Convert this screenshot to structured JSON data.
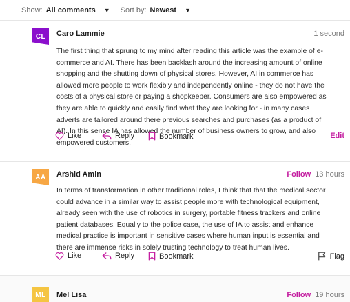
{
  "filters": {
    "show_label": "Show:",
    "show_value": "All comments",
    "sort_label": "Sort by:",
    "sort_value": "Newest"
  },
  "comments": [
    {
      "initials": "CL",
      "author": "Caro Lammie",
      "time": "1 second",
      "avatar_color": "#8b0fcc",
      "body": "The first thing that sprung to my mind after reading this article was the example of e-commerce and AI. There has been backlash around the increasing amount of online shopping and the shutting down of physical stores. However, AI in commerce has allowed more people to work flexibly and independently online - they do not have the costs of a physical store or paying a shopkeeper. Consumers are also empowered as they are able to quickly and easily find what they are looking for - in many cases adverts are tailored around there previous searches and purchases (as a product of AI). In this sense IA has allowed the number of business owners to grow, and also empowered customers.",
      "like_label": "Like",
      "reply_label": "Reply",
      "bookmark_label": "Bookmark",
      "edit_label": "Edit"
    },
    {
      "initials": "AA",
      "author": "Arshid Amin",
      "follow_label": "Follow",
      "time": "13 hours",
      "avatar_color": "#f7a744",
      "body": "In terms of transformation in other traditional roles, I think that that the medical sector could advance in a similar way to assist people more with technological equipment, already seen with the use of robotics in surgery, portable fitness trackers and online patient databases. Equally to the police case, the use of IA to assist and enhance medical practice is important in sensitive cases where human input is essential and there are immense risks in solely trusting technology to treat human lives.",
      "like_label": "Like",
      "reply_label": "Reply",
      "bookmark_label": "Bookmark",
      "flag_label": "Flag"
    },
    {
      "initials": "ML",
      "author": "Mel Lisa",
      "follow_label": "Follow",
      "time": "19 hours",
      "avatar_color": "#f5c542"
    }
  ],
  "icons": {
    "like": "heart-icon",
    "reply": "reply-arrow-icon",
    "bookmark": "bookmark-icon",
    "flag": "flag-icon",
    "dropdown": "caret-down-icon"
  },
  "colors": {
    "accent": "#c41ea0",
    "icon": "#c41ea0"
  }
}
